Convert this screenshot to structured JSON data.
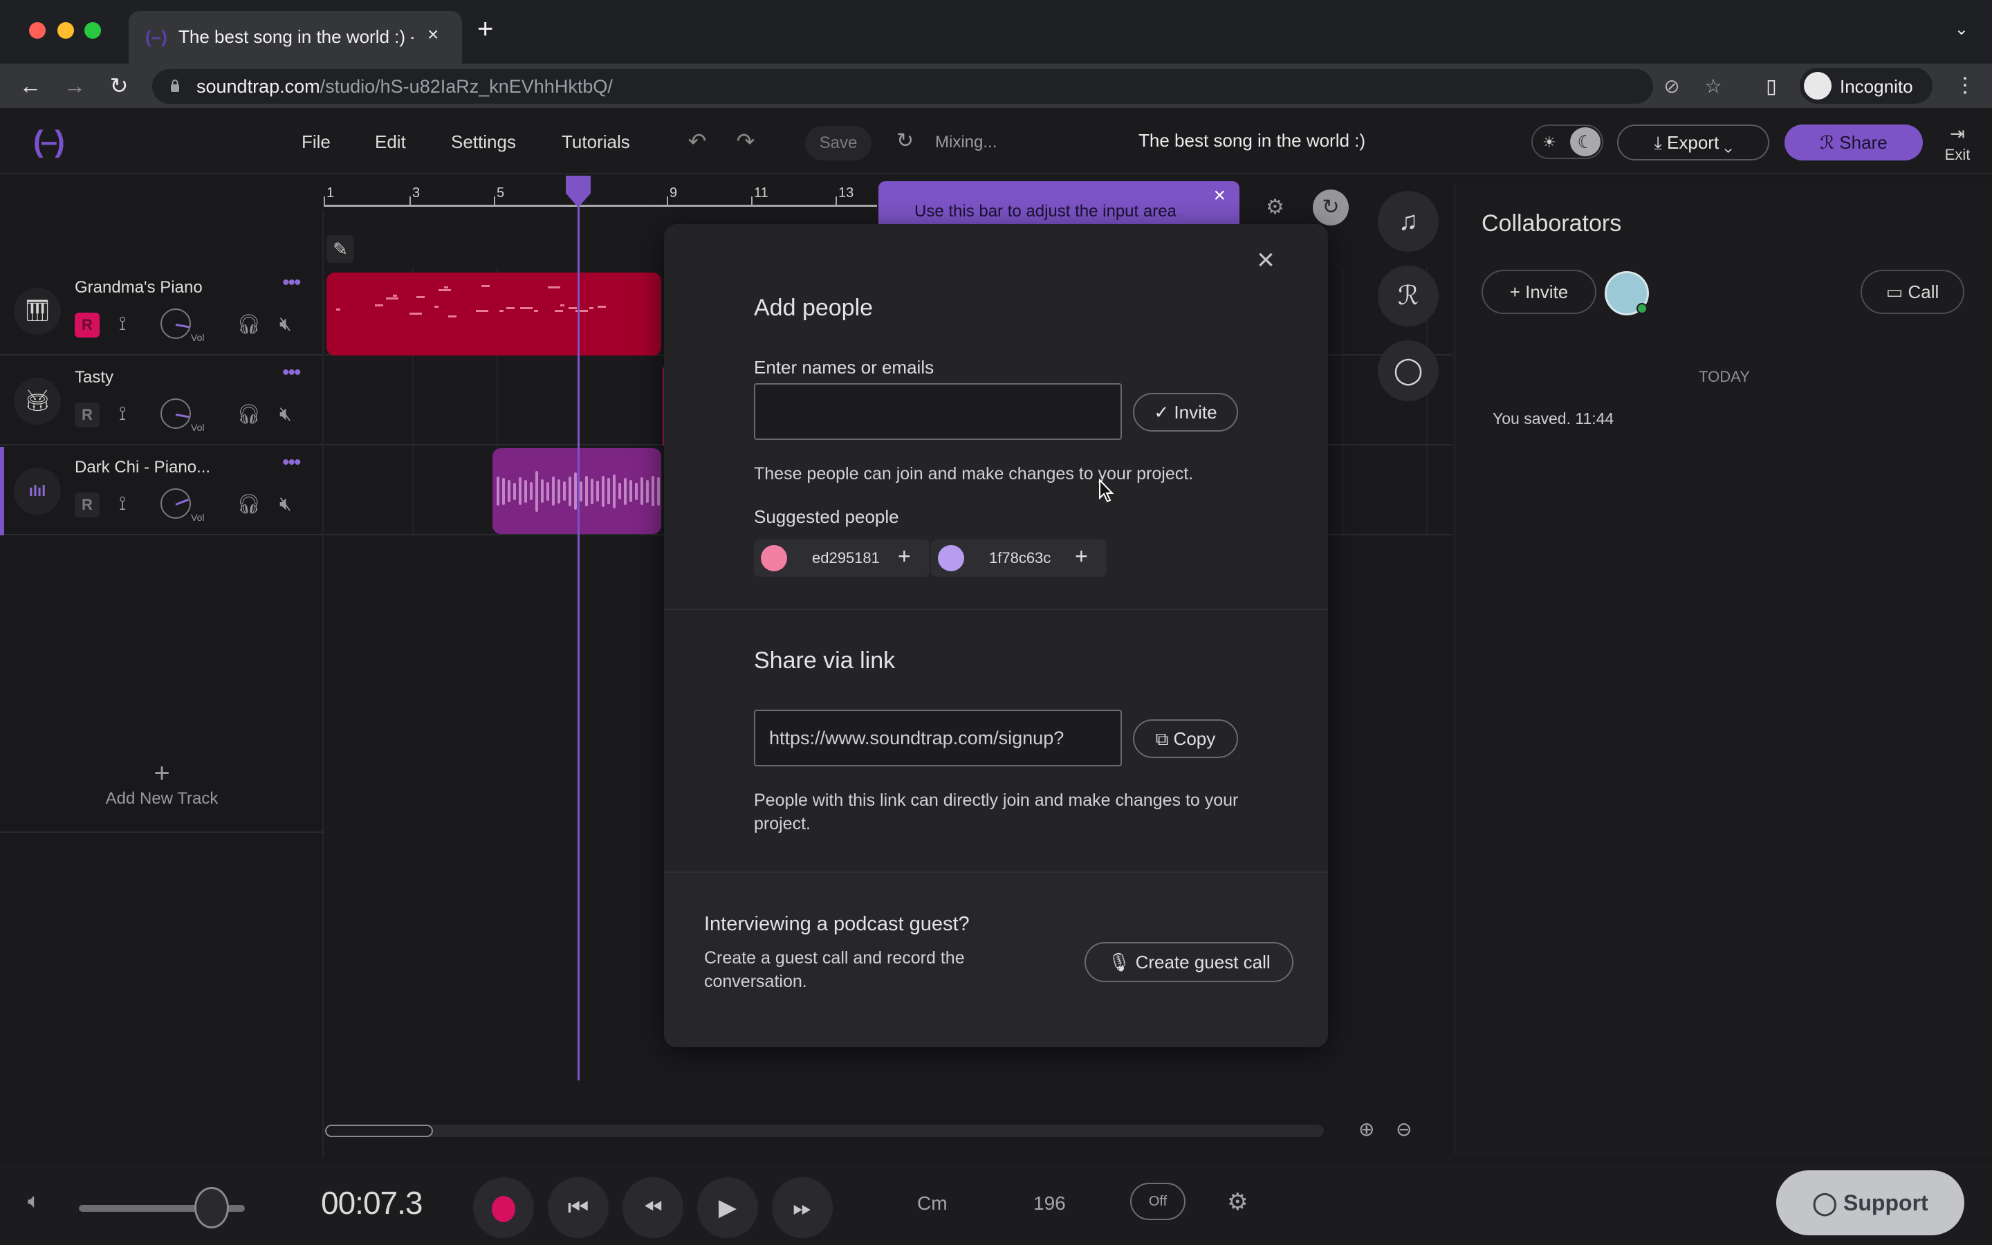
{
  "browser": {
    "tab_title": "The best song in the world :) - ",
    "tab_favicon": "(–)",
    "url_host": "soundtrap.com",
    "url_path": "/studio/hS-u82IaRz_knEVhhHktbQ/",
    "profile_label": "Incognito"
  },
  "app": {
    "logo": "(–)",
    "menu": [
      "File",
      "Edit",
      "Settings",
      "Tutorials"
    ],
    "save_label": "Save",
    "status": "Mixing...",
    "project_title": "The best song in the world :)",
    "export_label": "Export",
    "share_label": "Share",
    "exit_label": "Exit",
    "accent_color": "#7c54c6"
  },
  "ruler": {
    "bars": [
      "1",
      "3",
      "5",
      "9",
      "11",
      "13"
    ],
    "tooltip": "Use this bar to adjust the input area"
  },
  "tracks": [
    {
      "name": "Grandma's Piano",
      "icon": "piano-icon",
      "record_armed": true,
      "selected": false,
      "volume": 0.72
    },
    {
      "name": "Tasty",
      "icon": "drum-icon",
      "record_armed": false,
      "selected": false,
      "volume": 0.72
    },
    {
      "name": "Dark Chi - Piano...",
      "icon": "waveform-icon",
      "record_armed": false,
      "selected": true,
      "volume": 0.55
    }
  ],
  "track_controls": {
    "record": "R",
    "volume": "Vol"
  },
  "add_track_label": "Add New Track",
  "collaborators": {
    "title": "Collaborators",
    "invite_label": "Invite",
    "call_label": "Call",
    "day_label": "TODAY",
    "activity": [
      "You saved. 11:44"
    ]
  },
  "modal": {
    "add_people_title": "Add people",
    "names_label": "Enter names or emails",
    "names_value": "",
    "invite_label": "Invite",
    "invite_note": "These people can join and make changes to your project.",
    "suggested_title": "Suggested people",
    "suggested": [
      {
        "name": "ed295181",
        "color": "#f27fa4"
      },
      {
        "name": "1f78c63c",
        "color": "#b79cf0"
      }
    ],
    "share_title": "Share via link",
    "share_link": "https://www.soundtrap.com/signup?",
    "copy_label": "Copy",
    "share_note": "People with this link can directly join and make changes to your project.",
    "podcast_title": "Interviewing a podcast guest?",
    "podcast_note": "Create a guest call and record the conversation.",
    "guest_call_label": "Create guest call"
  },
  "transport": {
    "time": "00:07.3",
    "master_volume": 0.8,
    "key": "Cm",
    "tempo": "196",
    "metronome": "Off",
    "support_label": "Support",
    "record_color": "#d6105e"
  }
}
